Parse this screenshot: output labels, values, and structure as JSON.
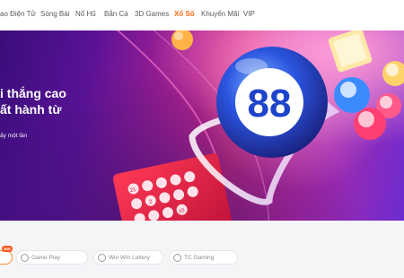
{
  "nav": {
    "items": [
      {
        "label": "ao Điện Tử"
      },
      {
        "label": "Sòng Bài"
      },
      {
        "label": "Nổ Hũ"
      },
      {
        "label": "Bắn Cá"
      },
      {
        "label": "3D Games"
      },
      {
        "label": "Xổ Số"
      },
      {
        "label": "Khuyến Mãi"
      },
      {
        "label": "VIP"
      }
    ],
    "active_index": 5,
    "active_color": "#ff6a13"
  },
  "hero": {
    "line1": "i thắng cao",
    "line2": "ất hành từ",
    "sub": "ấy một lần",
    "ball_number": "88",
    "ticket_numbers": [
      "21",
      "2",
      "10"
    ]
  },
  "providers": {
    "hot_badge": "Hot",
    "chips": [
      {
        "label": "Game Play",
        "icon": "gameplay-icon"
      },
      {
        "label": "Win Win Lottery",
        "icon": "winwin-icon"
      },
      {
        "label": "TC Gaming",
        "icon": "tc-gaming-icon"
      }
    ]
  },
  "colors": {
    "accent": "#ff6a13",
    "hero_purple": "#5a1297",
    "hero_pink": "#d62d7a",
    "ball_blue": "#2a55e0"
  }
}
